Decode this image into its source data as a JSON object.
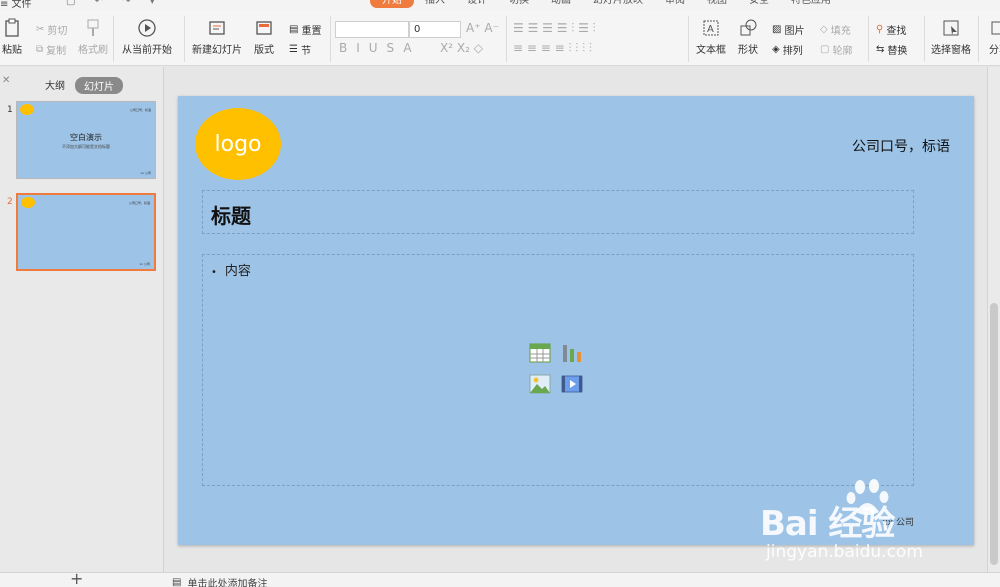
{
  "menu": {
    "file": "≡ 文件",
    "tabs": [
      {
        "label": "开始",
        "active": true
      },
      {
        "label": "插入"
      },
      {
        "label": "设计"
      },
      {
        "label": "切换"
      },
      {
        "label": "动画"
      },
      {
        "label": "幻灯片放映"
      },
      {
        "label": "审阅"
      },
      {
        "label": "视图"
      },
      {
        "label": "安全"
      },
      {
        "label": "特色应用"
      }
    ]
  },
  "ribbon": {
    "paste": "粘贴",
    "cut": "剪切",
    "copy": "复制",
    "format_painter": "格式刷",
    "play_from_current": "从当前开始",
    "new_slide": "新建幻灯片",
    "layout": "版式",
    "reset": "重置",
    "section": "节",
    "font_name": "",
    "font_size": "0",
    "text_box": "文本框",
    "shape": "形状",
    "picture": "图片",
    "fill": "填充",
    "arrange": "排列",
    "outline": "轮廓",
    "find": "查找",
    "replace": "替换",
    "select_pane": "选择窗格",
    "share": "分享"
  },
  "left_panel": {
    "tab_outline": "大纲",
    "tab_slides": "幻灯片",
    "slides": [
      {
        "num": "1",
        "title": "空白演示",
        "subtitle": "不添加大纲可能是文档标题",
        "selected": false
      },
      {
        "num": "2",
        "title": "",
        "subtitle": "",
        "selected": true
      }
    ]
  },
  "slide": {
    "logo_text": "logo",
    "slogan": "公司口号，标语",
    "title": "标题",
    "bullet": "内容",
    "footer": "xx 公司"
  },
  "notes": {
    "placeholder": "单击此处添加备注"
  },
  "watermark": {
    "brand": "Bai 经验",
    "url": "jingyan.baidu.com"
  },
  "colors": {
    "accent": "#f07b3f",
    "slide_bg": "#9dc3e6",
    "logo": "#ffc000"
  }
}
